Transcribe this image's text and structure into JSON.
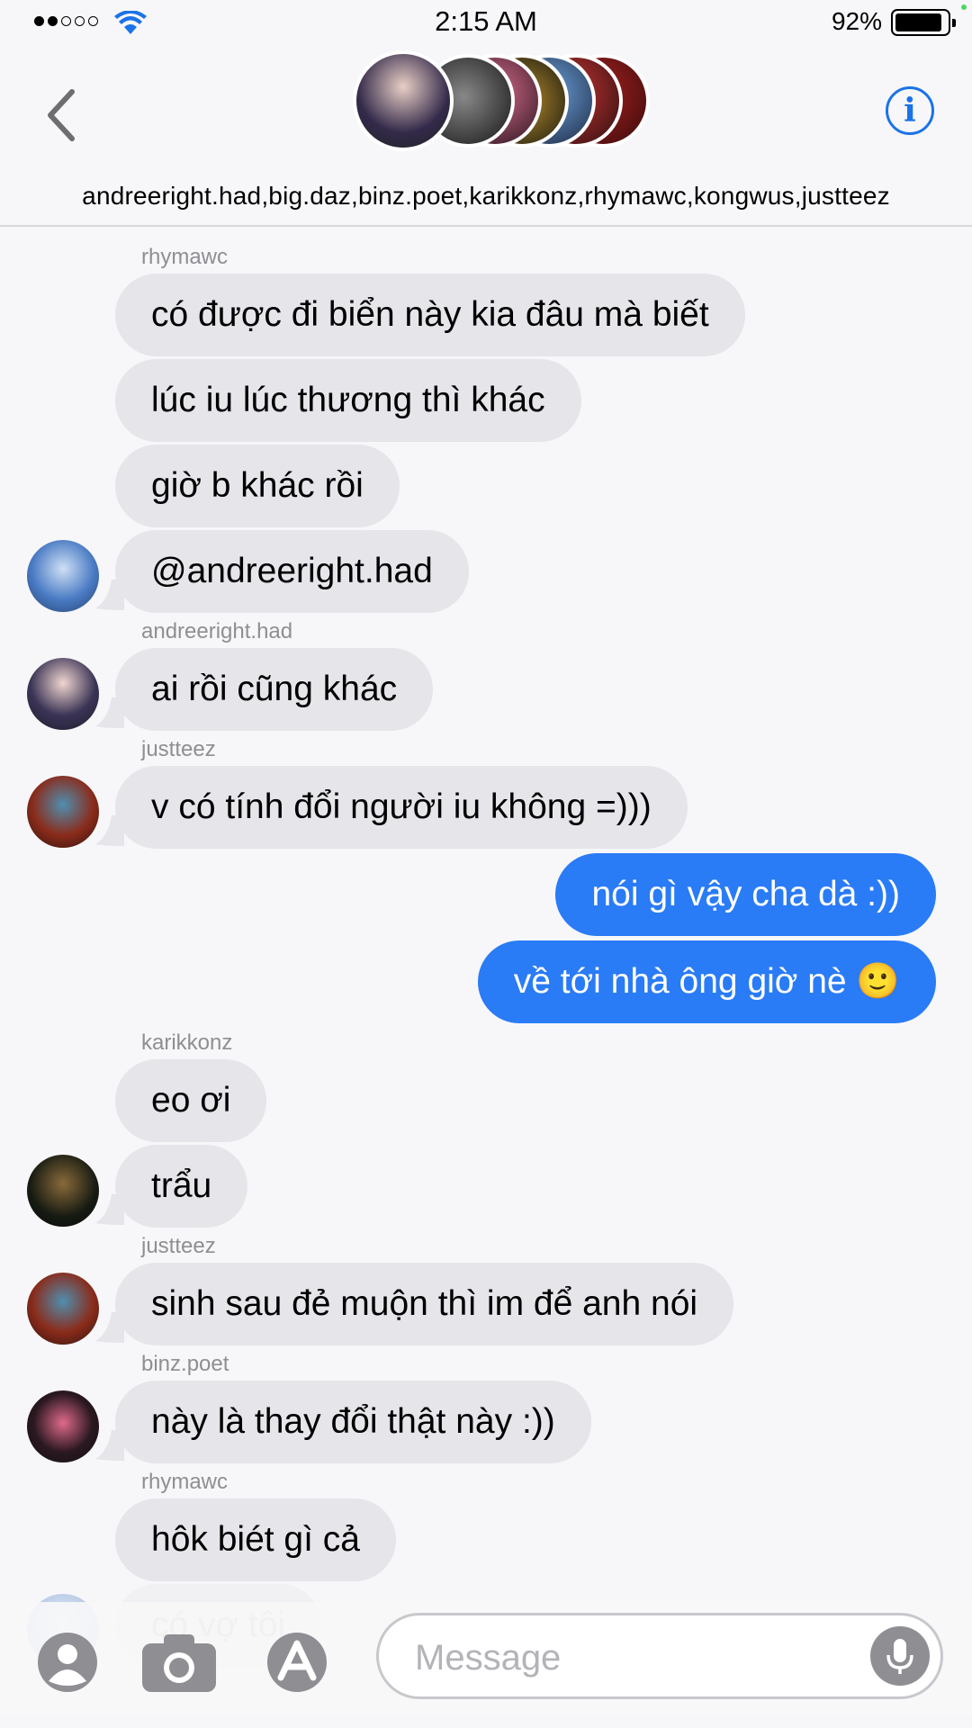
{
  "status_bar": {
    "time": "2:15 AM",
    "battery_percent": "92%",
    "signal_bars_filled": 2,
    "signal_bars_total": 5
  },
  "header": {
    "participants": "andreeright.had,big.daz,binz.poet,karikkonz,rhymawc,kongwus,justteez",
    "info_icon": "info-icon",
    "back_icon": "chevron-left-icon"
  },
  "messages": [
    {
      "sender": "rhymawc",
      "direction": "incoming",
      "text": "có được đi biển này kia đâu mà biết"
    },
    {
      "direction": "incoming",
      "text": "lúc iu lúc thương thì khác"
    },
    {
      "direction": "incoming",
      "text": "giờ b khác rồi"
    },
    {
      "direction": "incoming",
      "text": "@andreeright.had"
    },
    {
      "sender": "andreeright.had",
      "direction": "incoming",
      "text": "ai rồi cũng khác"
    },
    {
      "sender": "justteez",
      "direction": "incoming",
      "text": "v có tính đổi người iu không =)))"
    },
    {
      "direction": "outgoing",
      "text": "nói gì vậy cha dà :))"
    },
    {
      "direction": "outgoing",
      "text": "về tới nhà ông giờ nè 🙂"
    },
    {
      "sender": "karikkonz",
      "direction": "incoming",
      "text": "eo ơi"
    },
    {
      "direction": "incoming",
      "text": "trẩu"
    },
    {
      "sender": "justteez",
      "direction": "incoming",
      "text": "sinh sau đẻ muộn thì im để anh nói"
    },
    {
      "sender": "binz.poet",
      "direction": "incoming",
      "text": "này là thay đổi thật này :))"
    },
    {
      "sender": "rhymawc",
      "direction": "incoming",
      "text": "hôk biét gì cả"
    },
    {
      "direction": "incoming",
      "text": "có vợ tôi"
    }
  ],
  "input_bar": {
    "placeholder": "Message",
    "value": ""
  },
  "colors": {
    "outgoing_bubble": "#2a7bf6",
    "incoming_bubble": "#e5e5ea",
    "accent": "#1a73e8"
  }
}
